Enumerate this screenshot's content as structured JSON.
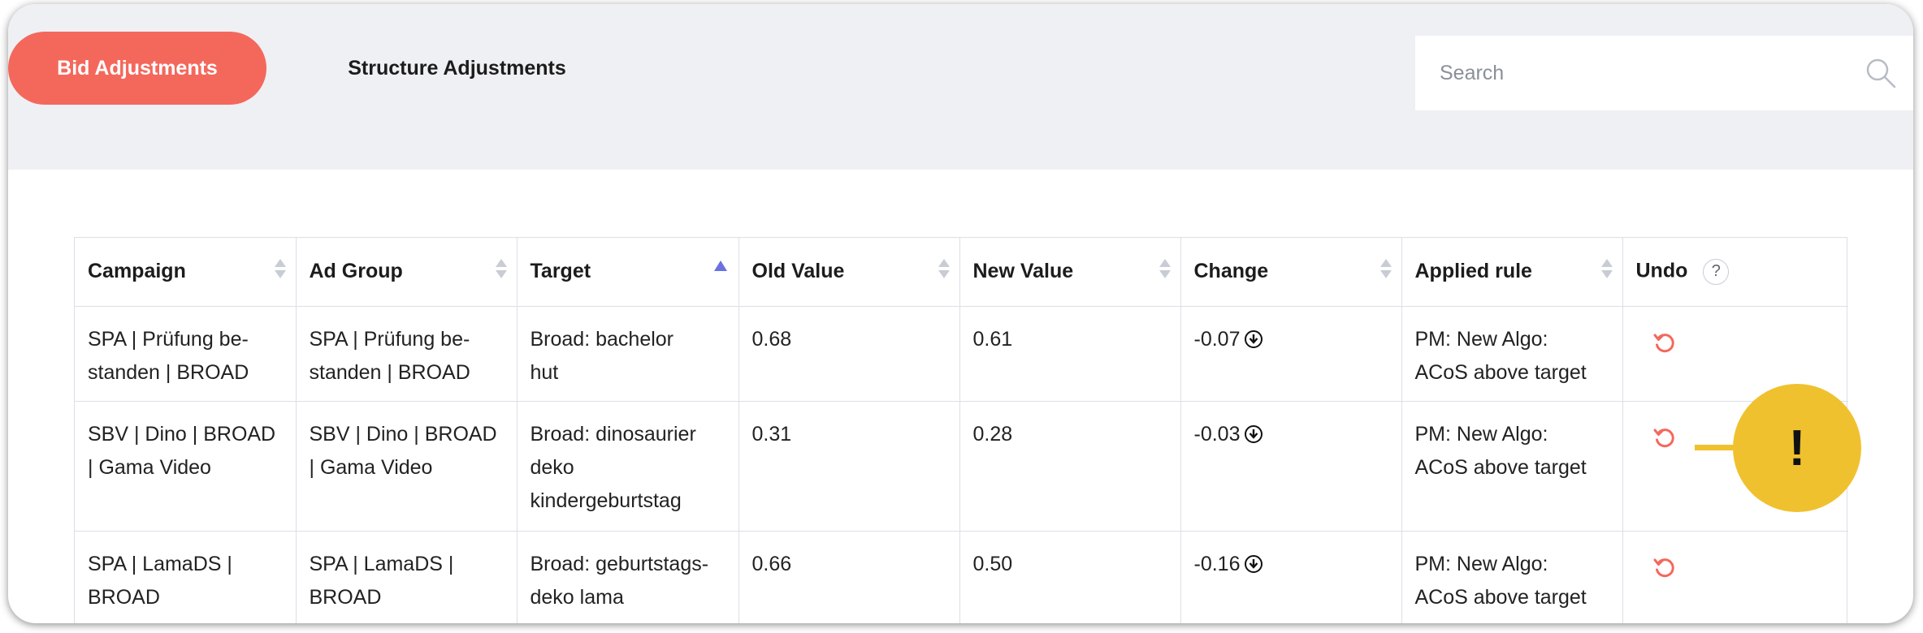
{
  "tabs": [
    {
      "label": "Bid Adjustments",
      "active": true
    },
    {
      "label": "Structure Adjustments",
      "active": false
    }
  ],
  "search": {
    "placeholder": "Search",
    "value": ""
  },
  "table": {
    "headers": [
      "Campaign",
      "Ad Group",
      "Target",
      "Old Value",
      "New Value",
      "Change",
      "Applied rule",
      "Undo"
    ],
    "sorted_column": "Target",
    "help_glyph": "?",
    "rows": [
      {
        "campaign": [
          "SPA | Prüfung be-",
          "standen | BROAD"
        ],
        "ad_group": [
          "SPA | Prüfung be-",
          "standen | BROAD"
        ],
        "target": [
          "Broad: bachelor",
          "hut"
        ],
        "old_value": "0.68",
        "new_value": "0.61",
        "change": "-0.07",
        "applied_rule": [
          "PM: New Algo:",
          "ACoS above target"
        ]
      },
      {
        "campaign": [
          "SBV | Dino | BROAD",
          "| Gama Video"
        ],
        "ad_group": [
          "SBV | Dino | BROAD",
          "| Gama Video"
        ],
        "target": [
          "Broad: dinosaurier",
          "deko",
          "kindergeburtstag"
        ],
        "old_value": "0.31",
        "new_value": "0.28",
        "change": "-0.03",
        "applied_rule": [
          "PM: New Algo:",
          "ACoS above target"
        ]
      },
      {
        "campaign": [
          "SPA | LamaDS |",
          "BROAD"
        ],
        "ad_group": [
          "SPA | LamaDS |",
          "BROAD"
        ],
        "target": [
          "Broad: geburtstags-",
          "deko lama"
        ],
        "old_value": "0.66",
        "new_value": "0.50",
        "change": "-0.16",
        "applied_rule": [
          "PM: New Algo:",
          "ACoS above target"
        ]
      }
    ]
  },
  "callout": {
    "glyph": "!"
  },
  "colors": {
    "accent": "#f4685c",
    "topbar_bg": "#eef0f4",
    "sort_active": "#6b71e0",
    "callout": "#f0c12f",
    "undo": "#f4685c"
  },
  "icons": [
    "search-icon",
    "sort-icon",
    "help-icon",
    "arrow-down-circle-icon",
    "undo-icon"
  ]
}
